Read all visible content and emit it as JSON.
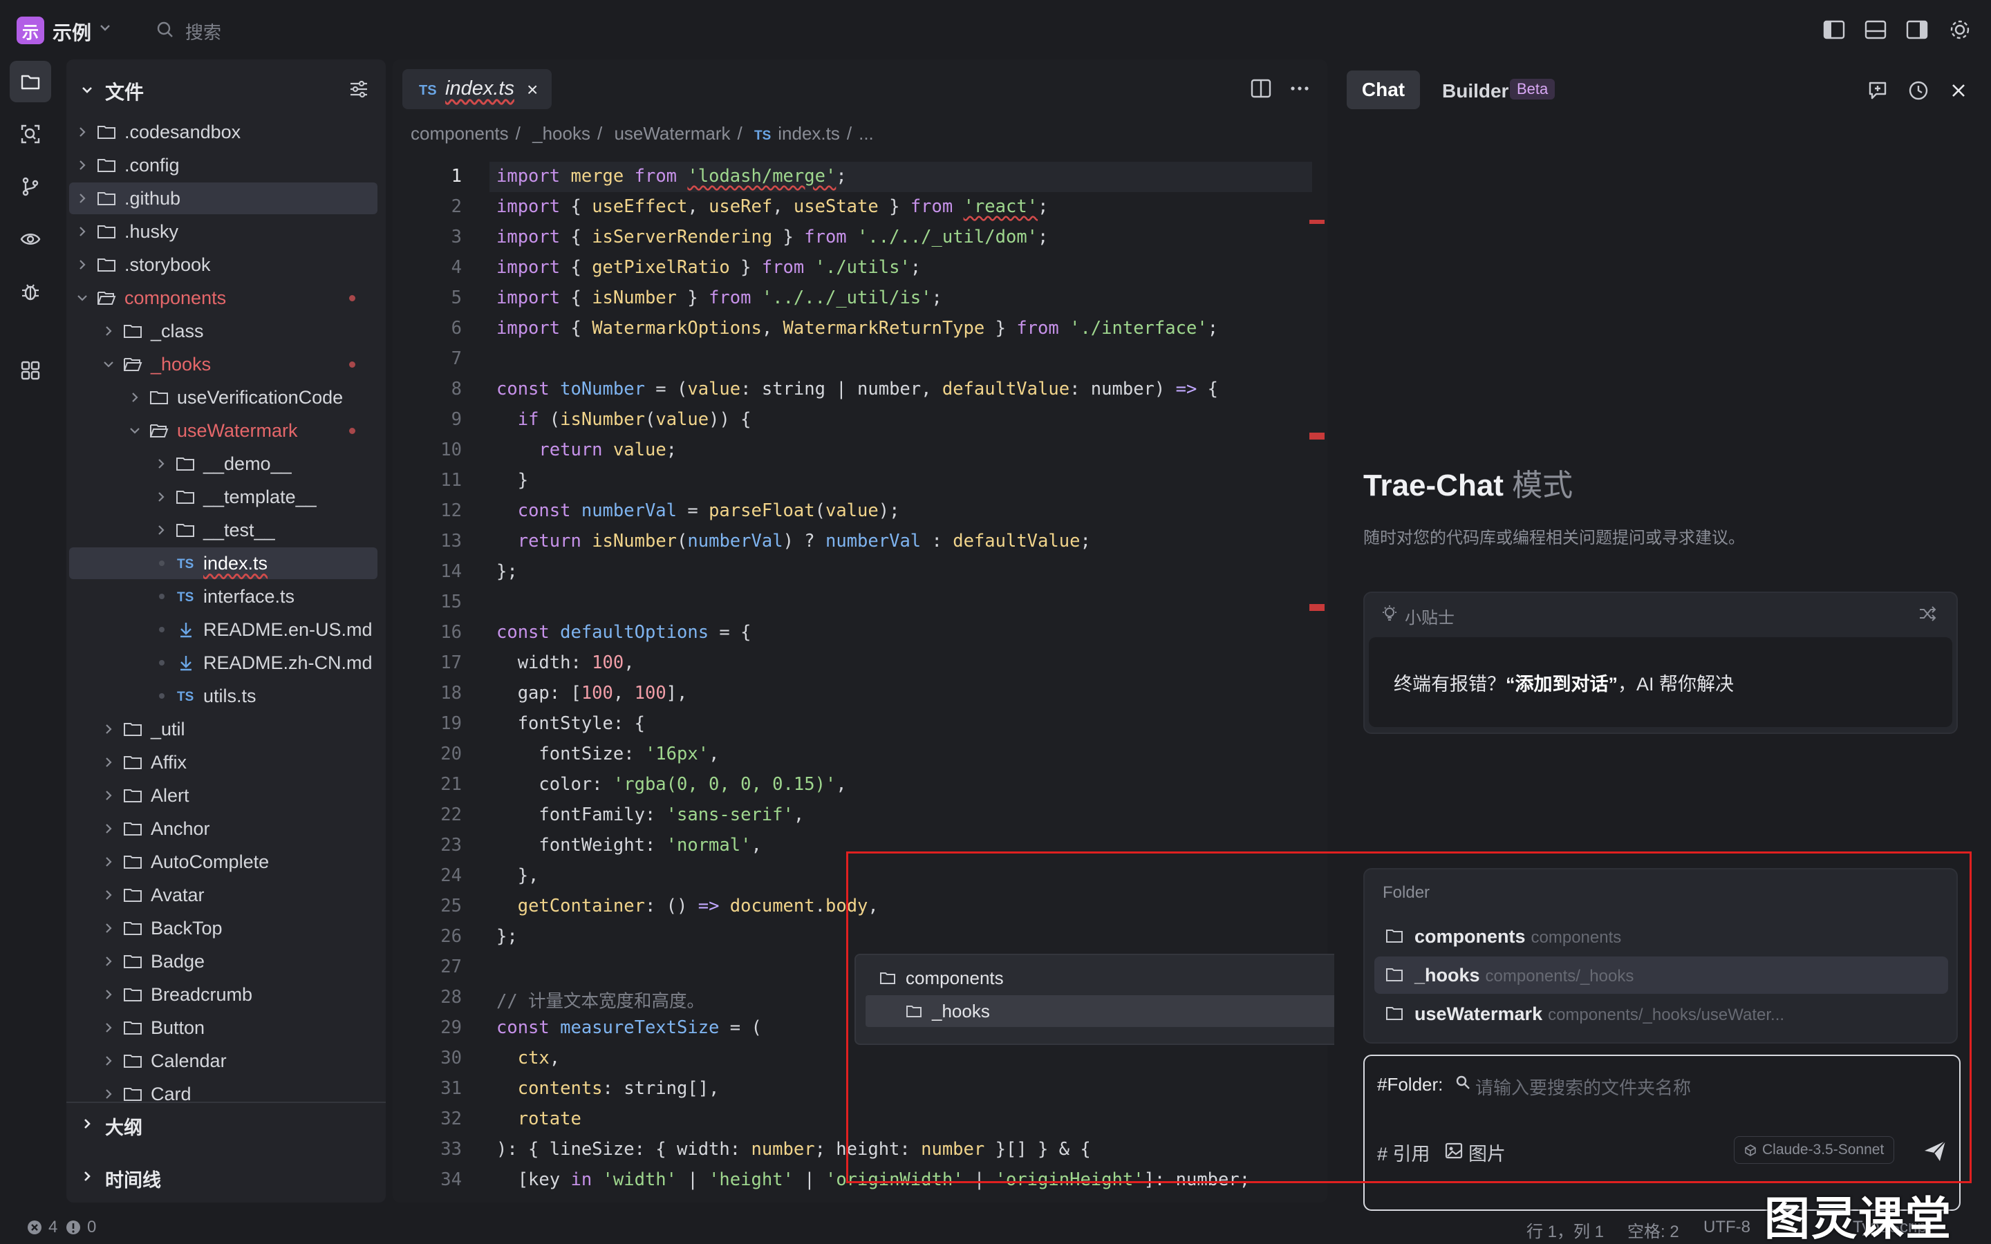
{
  "titlebar": {
    "logo_text": "示",
    "project": "示例",
    "search_placeholder": "搜索"
  },
  "explorer": {
    "title": "文件",
    "rows": [
      {
        "label": ".codesandbox"
      },
      {
        "label": ".config"
      },
      {
        "label": ".github"
      },
      {
        "label": ".husky"
      },
      {
        "label": ".storybook"
      },
      {
        "label": "components"
      },
      {
        "label": "_class"
      },
      {
        "label": "_hooks"
      },
      {
        "label": "useVerificationCode"
      },
      {
        "label": "useWatermark"
      },
      {
        "label": "__demo__"
      },
      {
        "label": "__template__"
      },
      {
        "label": "__test__"
      },
      {
        "label": "index.ts",
        "badge": "TS"
      },
      {
        "label": "interface.ts",
        "badge": "TS"
      },
      {
        "label": "README.en-US.md"
      },
      {
        "label": "README.zh-CN.md"
      },
      {
        "label": "utils.ts",
        "badge": "TS"
      },
      {
        "label": "_util"
      },
      {
        "label": "Affix"
      },
      {
        "label": "Alert"
      },
      {
        "label": "Anchor"
      },
      {
        "label": "AutoComplete"
      },
      {
        "label": "Avatar"
      },
      {
        "label": "BackTop"
      },
      {
        "label": "Badge"
      },
      {
        "label": "Breadcrumb"
      },
      {
        "label": "Button"
      },
      {
        "label": "Calendar"
      },
      {
        "label": "Card"
      }
    ],
    "outline": "大纲",
    "timeline": "时间线"
  },
  "editor": {
    "tab": {
      "badge": "TS",
      "name": "index.ts",
      "close": "×"
    },
    "breadcrumb": [
      "components",
      "/",
      "_hooks",
      "/",
      "useWatermark",
      "/",
      "TS",
      "index.ts",
      "/",
      "..."
    ],
    "line_numbers": [
      "1",
      "2",
      "3",
      "4",
      "5",
      "6",
      "7",
      "8",
      "9",
      "10",
      "11",
      "12",
      "13",
      "14",
      "15",
      "16",
      "17",
      "18",
      "19",
      "20",
      "21",
      "22",
      "23",
      "24",
      "25",
      "26",
      "27",
      "28",
      "29",
      "30",
      "31",
      "32",
      "33",
      "34"
    ]
  },
  "suggest": {
    "items": [
      "components",
      "_hooks"
    ]
  },
  "chat": {
    "tabs": {
      "chat": "Chat",
      "builder": "Builder",
      "beta": "Beta"
    },
    "heading": "Trae-Chat",
    "heading_mode": "模式",
    "subtitle": "随时对您的代码库或编程相关问题提问或寻求建议。",
    "tips": {
      "label": "小贴士",
      "text_a": "终端有报错？",
      "text_b": "“添加到对话”",
      "text_c": "，AI 帮你解决"
    },
    "folder_popup": {
      "title": "Folder",
      "items": [
        {
          "name": "components",
          "path": "components"
        },
        {
          "name": "_hooks",
          "path": "components/_hooks"
        },
        {
          "name": "useWatermark",
          "path": "components/_hooks/useWater..."
        }
      ]
    },
    "input": {
      "prefix": "#Folder:",
      "placeholder": "请输入要搜索的文件夹名称",
      "ref_label": "# 引用",
      "image_label": "图片",
      "model": "Claude-3.5-Sonnet"
    }
  },
  "statusbar": {
    "errors": "4",
    "warnings": "0",
    "position": "行 1，列 1",
    "spaces": "空格: 2",
    "encoding": "UTF-8",
    "language": "TypeScript"
  },
  "watermark": "图灵课堂",
  "colors": {
    "accent": "#b25ee6",
    "error": "#e02020",
    "folder_red": "#e5676a",
    "ts_blue": "#6ba6e6"
  }
}
